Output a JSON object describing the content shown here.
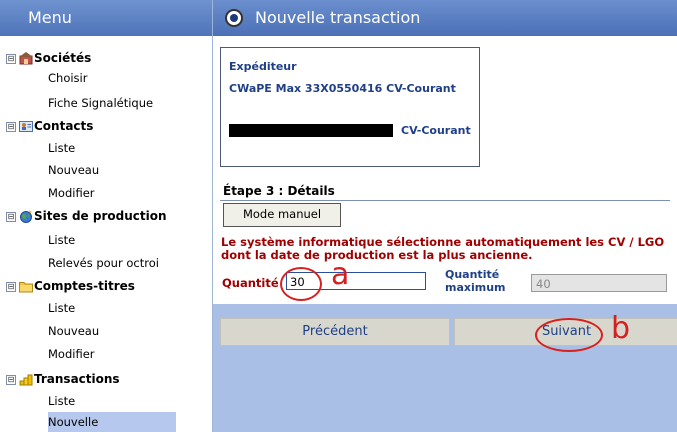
{
  "sidebar": {
    "header": "Menu",
    "sections": [
      {
        "label": "Sociétés",
        "icon": "company-icon",
        "toggle": "⊟",
        "items": [
          "Choisir",
          "Fiche Signalétique"
        ]
      },
      {
        "label": "Contacts",
        "icon": "contacts-icon",
        "toggle": "⊟",
        "items": [
          "Liste",
          "Nouveau",
          "Modifier"
        ]
      },
      {
        "label": "Sites de production",
        "icon": "globe-icon",
        "toggle": "⊟",
        "items": [
          "Liste",
          "Relevés pour octroi"
        ]
      },
      {
        "label": "Comptes-titres",
        "icon": "folder-icon",
        "toggle": "⊟",
        "items": [
          "Liste",
          "Nouveau",
          "Modifier"
        ]
      },
      {
        "label": "Transactions",
        "icon": "coins-icon",
        "toggle": "⊟",
        "items": [
          "Liste",
          "Nouvelle"
        ]
      }
    ],
    "selected_item": "Nouvelle"
  },
  "main": {
    "title": "Nouvelle transaction",
    "sender": {
      "heading": "Expéditeur",
      "line1": "CWaPE Max  33X0550416  CV-Courant",
      "line2_suffix": "CV-Courant"
    },
    "step_title": "Étape 3 : Détails",
    "mode_button": "Mode manuel",
    "info_text": "Le système informatique sélectionne automatiquement les CV / LGO dont la date de production est la plus ancienne.",
    "quantity_label": "Quantité",
    "quantity_value": "30",
    "annotation_a": "a",
    "quantity_max_label_line1": "Quantité",
    "quantity_max_label_line2": "maximum",
    "quantity_max_value": "40",
    "prev_button": "Précédent",
    "next_button": "Suivant",
    "annotation_b": "b"
  },
  "colors": {
    "header_blue": "#5a7fc4",
    "sidebar_selected": "#b7c8ee",
    "main_background": "#a9bfe5",
    "warning_red": "#a00000",
    "label_blue": "#1f3f86",
    "annotation_red": "#d42020"
  }
}
